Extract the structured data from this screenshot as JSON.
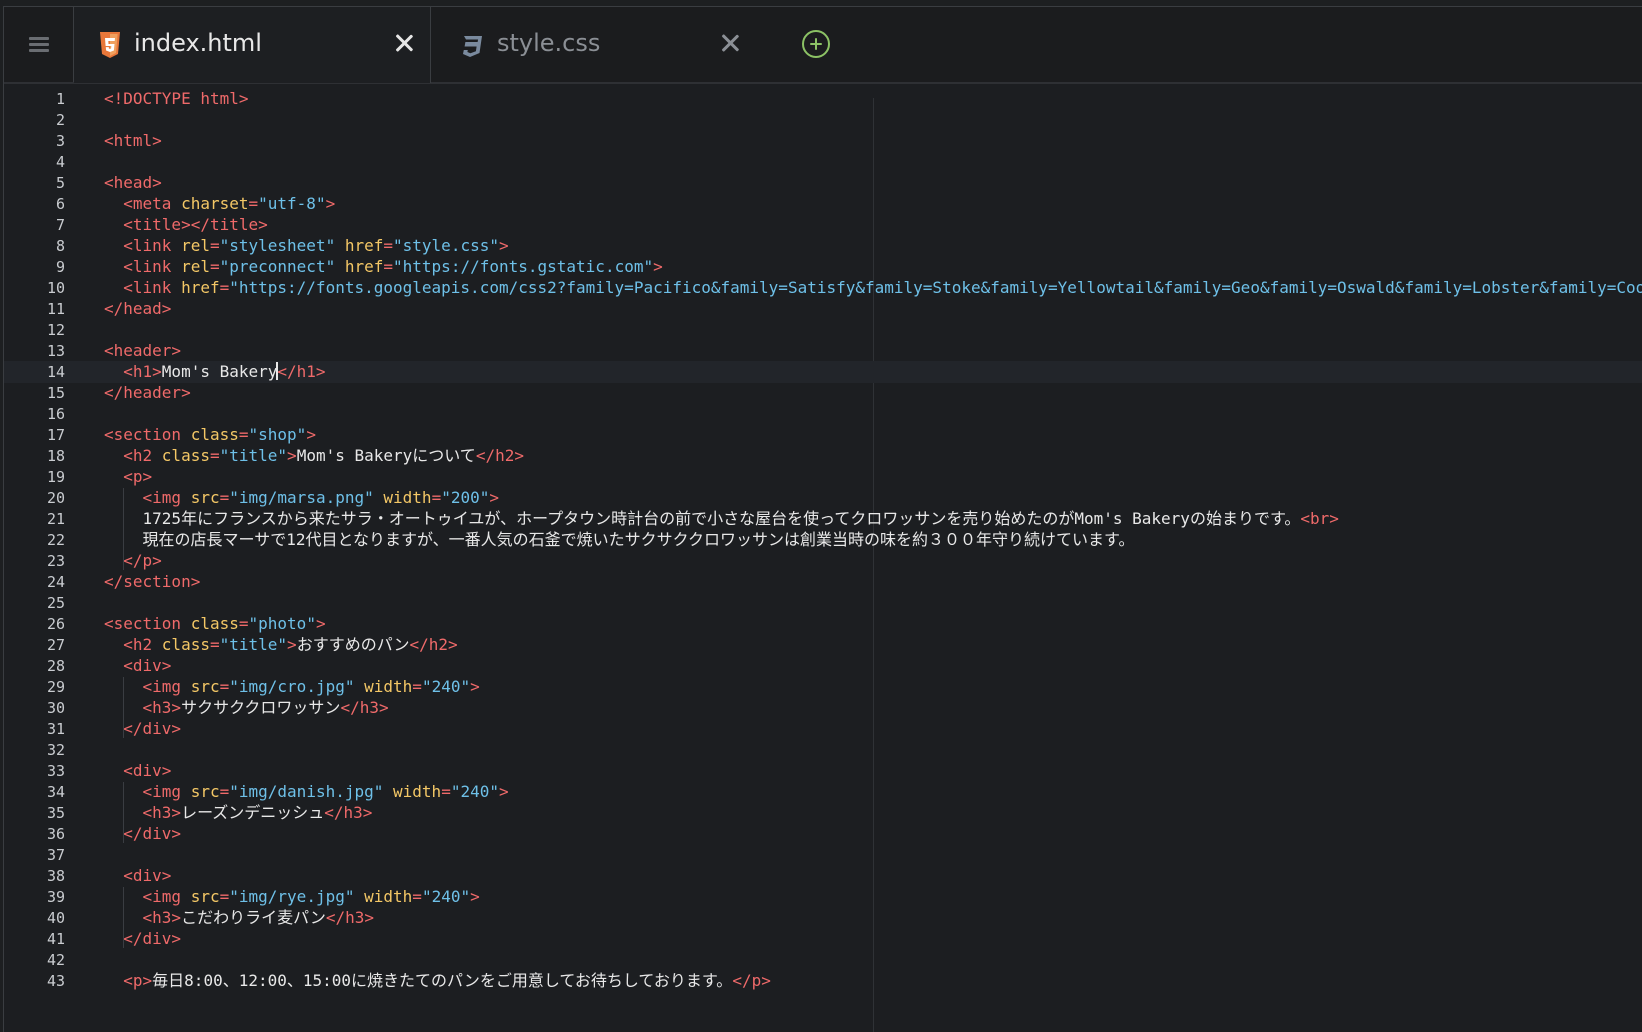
{
  "menu": {
    "icon": "hamburger-icon"
  },
  "tabs": [
    {
      "label": "index.html",
      "icon": "html5-file-icon",
      "active": true
    },
    {
      "label": "style.css",
      "icon": "css3-file-icon",
      "active": false
    }
  ],
  "add_tab": {
    "icon": "plus-circle-icon"
  },
  "editor": {
    "cursor_line": 14,
    "lines": [
      [
        [
          "tag",
          "<!DOCTYPE html>"
        ]
      ],
      [],
      [
        [
          "tag",
          "<html>"
        ]
      ],
      [],
      [
        [
          "tag",
          "<head>"
        ]
      ],
      [
        [
          "txt",
          "  "
        ],
        [
          "tag",
          "<meta "
        ],
        [
          "attr",
          "charset"
        ],
        [
          "tag",
          "="
        ],
        [
          "val",
          "\"utf-8\""
        ],
        [
          "tag",
          ">"
        ]
      ],
      [
        [
          "txt",
          "  "
        ],
        [
          "tag",
          "<title></title>"
        ]
      ],
      [
        [
          "txt",
          "  "
        ],
        [
          "tag",
          "<link "
        ],
        [
          "attr",
          "rel"
        ],
        [
          "tag",
          "="
        ],
        [
          "val",
          "\"stylesheet\""
        ],
        [
          "txt",
          " "
        ],
        [
          "attr",
          "href"
        ],
        [
          "tag",
          "="
        ],
        [
          "val",
          "\"style.css\""
        ],
        [
          "tag",
          ">"
        ]
      ],
      [
        [
          "txt",
          "  "
        ],
        [
          "tag",
          "<link "
        ],
        [
          "attr",
          "rel"
        ],
        [
          "tag",
          "="
        ],
        [
          "val",
          "\"preconnect\""
        ],
        [
          "txt",
          " "
        ],
        [
          "attr",
          "href"
        ],
        [
          "tag",
          "="
        ],
        [
          "val",
          "\"https://fonts.gstatic.com\""
        ],
        [
          "tag",
          ">"
        ]
      ],
      [
        [
          "txt",
          "  "
        ],
        [
          "tag",
          "<link "
        ],
        [
          "attr",
          "href"
        ],
        [
          "tag",
          "="
        ],
        [
          "val",
          "\"https://fonts.googleapis.com/css2?family=Pacifico&family=Satisfy&family=Stoke&family=Yellowtail&family=Geo&family=Oswald&family=Lobster&family=Coo"
        ]
      ],
      [
        [
          "tag",
          "</head>"
        ]
      ],
      [],
      [
        [
          "tag",
          "<header>"
        ]
      ],
      [
        [
          "txt",
          "  "
        ],
        [
          "tag",
          "<h1>"
        ],
        [
          "txt",
          "Mom's Bakery"
        ],
        [
          "cursor",
          ""
        ],
        [
          "tag",
          "</h1>"
        ]
      ],
      [
        [
          "tag",
          "</header>"
        ]
      ],
      [],
      [
        [
          "tag",
          "<section "
        ],
        [
          "attr",
          "class"
        ],
        [
          "tag",
          "="
        ],
        [
          "val",
          "\"shop\""
        ],
        [
          "tag",
          ">"
        ]
      ],
      [
        [
          "txt",
          "  "
        ],
        [
          "tag",
          "<h2 "
        ],
        [
          "attr",
          "class"
        ],
        [
          "tag",
          "="
        ],
        [
          "val",
          "\"title\""
        ],
        [
          "tag",
          ">"
        ],
        [
          "txt",
          "Mom's Bakeryについて"
        ],
        [
          "tag",
          "</h2>"
        ]
      ],
      [
        [
          "txt",
          "  "
        ],
        [
          "tag",
          "<p>"
        ]
      ],
      [
        [
          "txt",
          "    "
        ],
        [
          "tag",
          "<img "
        ],
        [
          "attr",
          "src"
        ],
        [
          "tag",
          "="
        ],
        [
          "val",
          "\"img/marsa.png\""
        ],
        [
          "txt",
          " "
        ],
        [
          "attr",
          "width"
        ],
        [
          "tag",
          "="
        ],
        [
          "val",
          "\"200\""
        ],
        [
          "tag",
          ">"
        ]
      ],
      [
        [
          "txt",
          "    1725年にフランスから来たサラ・オートゥイユが、ホープタウン時計台の前で小さな屋台を使ってクロワッサンを売り始めたのがMom's Bakeryの始まりです。"
        ],
        [
          "tag",
          "<br>"
        ]
      ],
      [
        [
          "txt",
          "    現在の店長マーサで12代目となりますが、一番人気の石釜で焼いたサクサククロワッサンは創業当時の味を約３００年守り続けています。"
        ]
      ],
      [
        [
          "txt",
          "  "
        ],
        [
          "tag",
          "</p>"
        ]
      ],
      [
        [
          "tag",
          "</section>"
        ]
      ],
      [],
      [
        [
          "tag",
          "<section "
        ],
        [
          "attr",
          "class"
        ],
        [
          "tag",
          "="
        ],
        [
          "val",
          "\"photo\""
        ],
        [
          "tag",
          ">"
        ]
      ],
      [
        [
          "txt",
          "  "
        ],
        [
          "tag",
          "<h2 "
        ],
        [
          "attr",
          "class"
        ],
        [
          "tag",
          "="
        ],
        [
          "val",
          "\"title\""
        ],
        [
          "tag",
          ">"
        ],
        [
          "txt",
          "おすすめのパン"
        ],
        [
          "tag",
          "</h2>"
        ]
      ],
      [
        [
          "txt",
          "  "
        ],
        [
          "tag",
          "<div>"
        ]
      ],
      [
        [
          "txt",
          "    "
        ],
        [
          "tag",
          "<img "
        ],
        [
          "attr",
          "src"
        ],
        [
          "tag",
          "="
        ],
        [
          "val",
          "\"img/cro.jpg\""
        ],
        [
          "txt",
          " "
        ],
        [
          "attr",
          "width"
        ],
        [
          "tag",
          "="
        ],
        [
          "val",
          "\"240\""
        ],
        [
          "tag",
          ">"
        ]
      ],
      [
        [
          "txt",
          "    "
        ],
        [
          "tag",
          "<h3>"
        ],
        [
          "txt",
          "サクサククロワッサン"
        ],
        [
          "tag",
          "</h3>"
        ]
      ],
      [
        [
          "txt",
          "  "
        ],
        [
          "tag",
          "</div>"
        ]
      ],
      [],
      [
        [
          "txt",
          "  "
        ],
        [
          "tag",
          "<div>"
        ]
      ],
      [
        [
          "txt",
          "    "
        ],
        [
          "tag",
          "<img "
        ],
        [
          "attr",
          "src"
        ],
        [
          "tag",
          "="
        ],
        [
          "val",
          "\"img/danish.jpg\""
        ],
        [
          "txt",
          " "
        ],
        [
          "attr",
          "width"
        ],
        [
          "tag",
          "="
        ],
        [
          "val",
          "\"240\""
        ],
        [
          "tag",
          ">"
        ]
      ],
      [
        [
          "txt",
          "    "
        ],
        [
          "tag",
          "<h3>"
        ],
        [
          "txt",
          "レーズンデニッシュ"
        ],
        [
          "tag",
          "</h3>"
        ]
      ],
      [
        [
          "txt",
          "  "
        ],
        [
          "tag",
          "</div>"
        ]
      ],
      [],
      [
        [
          "txt",
          "  "
        ],
        [
          "tag",
          "<div>"
        ]
      ],
      [
        [
          "txt",
          "    "
        ],
        [
          "tag",
          "<img "
        ],
        [
          "attr",
          "src"
        ],
        [
          "tag",
          "="
        ],
        [
          "val",
          "\"img/rye.jpg\""
        ],
        [
          "txt",
          " "
        ],
        [
          "attr",
          "width"
        ],
        [
          "tag",
          "="
        ],
        [
          "val",
          "\"240\""
        ],
        [
          "tag",
          ">"
        ]
      ],
      [
        [
          "txt",
          "    "
        ],
        [
          "tag",
          "<h3>"
        ],
        [
          "txt",
          "こだわりライ麦パン"
        ],
        [
          "tag",
          "</h3>"
        ]
      ],
      [
        [
          "txt",
          "  "
        ],
        [
          "tag",
          "</div>"
        ]
      ],
      [],
      [
        [
          "txt",
          "  "
        ],
        [
          "tag",
          "<p>"
        ],
        [
          "txt",
          "毎日8:00、12:00、15:00に焼きたてのパンをご用意してお待ちしております。"
        ],
        [
          "tag",
          "</p>"
        ]
      ]
    ]
  }
}
